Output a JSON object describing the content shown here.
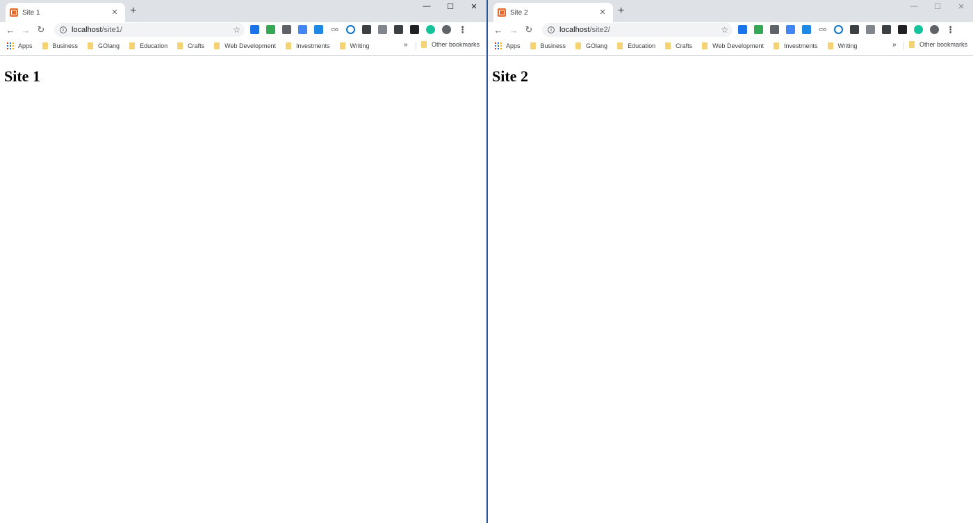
{
  "windows": [
    {
      "tab_title": "Site 1",
      "url_host": "localhost",
      "url_path": "/site1/",
      "page_heading": "Site 1"
    },
    {
      "tab_title": "Site 2",
      "url_host": "localhost",
      "url_path": "/site2/",
      "page_heading": "Site 2"
    }
  ],
  "tab": {
    "close_glyph": "✕",
    "new_tab_glyph": "+"
  },
  "window_controls": {
    "minimize": "—",
    "maximize": "☐",
    "close": "✕"
  },
  "nav": {
    "back": "←",
    "forward": "→",
    "reload": "↻",
    "star": "☆",
    "info": "i"
  },
  "extensions": [
    {
      "icon": "cloud-icon",
      "color": "#1a73e8",
      "text": ""
    },
    {
      "icon": "google-drive-icon",
      "color": "#34a853",
      "text": ""
    },
    {
      "icon": "scissors-icon",
      "color": "#5f6368",
      "text": ""
    },
    {
      "icon": "translate-icon",
      "color": "#4285f4",
      "text": ""
    },
    {
      "icon": "highlighter-icon",
      "color": "#1e88e5",
      "text": ""
    },
    {
      "icon": "css-icon",
      "color": "#ffffff",
      "text": "css"
    },
    {
      "icon": "ring-icon",
      "color": "#0b73c9",
      "text": ""
    },
    {
      "icon": "pen-tool-icon",
      "color": "#3c4043",
      "text": ""
    },
    {
      "icon": "v-icon",
      "color": "#80868b",
      "text": ""
    },
    {
      "icon": "headphones-icon",
      "color": "#3c4043",
      "text": ""
    },
    {
      "icon": "terminal-icon",
      "color": "#202124",
      "text": ""
    },
    {
      "icon": "grammarly-icon",
      "color": "#15c39a",
      "text": ""
    },
    {
      "icon": "avatar-icon",
      "color": "#5f6368",
      "text": ""
    },
    {
      "icon": "menu-dots-icon",
      "color": "#ffffff",
      "text": "⋮"
    }
  ],
  "bookmarks": {
    "apps_label": "Apps",
    "items": [
      "Business",
      "GOlang",
      "Education",
      "Crafts",
      "Web Development",
      "Investments",
      "Writing"
    ],
    "overflow_glyph": "»",
    "other_label": "Other bookmarks"
  },
  "colors": {
    "tabstrip": "#dee1e6",
    "folder": "#f5d373",
    "window_divider": "#2b579a",
    "favicon": "#e8692c"
  }
}
